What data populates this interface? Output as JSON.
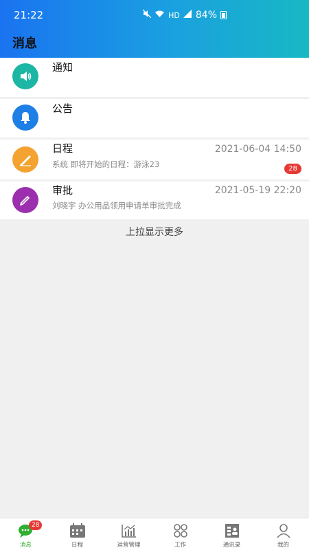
{
  "status_bar": {
    "time": "21:22",
    "network": "HD",
    "battery": "84%"
  },
  "header": {
    "title": "消息"
  },
  "messages": [
    {
      "title": "通知",
      "subtitle": "",
      "time": "",
      "badge": "",
      "icon": "speaker-icon",
      "color": "#1bb6a4"
    },
    {
      "title": "公告",
      "subtitle": "",
      "time": "",
      "badge": "",
      "icon": "bell-icon",
      "color": "#1e7fe6"
    },
    {
      "title": "日程",
      "subtitle": "系统 即将开始的日程：游泳23",
      "time": "2021-06-04 14:50",
      "badge": "28",
      "icon": "pen-icon",
      "color": "#f4a230"
    },
    {
      "title": "审批",
      "subtitle": "刘晓宇 办公用品领用申请单审批完成",
      "time": "2021-05-19 22:20",
      "badge": "",
      "icon": "edit-icon",
      "color": "#9b2fae"
    }
  ],
  "load_more": "上拉显示更多",
  "tabs": [
    {
      "label": "消息",
      "badge": "28",
      "icon": "chat-icon",
      "active": true
    },
    {
      "label": "日程",
      "icon": "calendar-icon"
    },
    {
      "label": "运营管理",
      "icon": "chart-icon"
    },
    {
      "label": "工作",
      "icon": "grid-icon"
    },
    {
      "label": "通讯录",
      "icon": "contacts-icon"
    },
    {
      "label": "我的",
      "icon": "person-icon"
    }
  ],
  "colors": {
    "active_tab": "#2fae2f",
    "badge": "#e53935"
  }
}
